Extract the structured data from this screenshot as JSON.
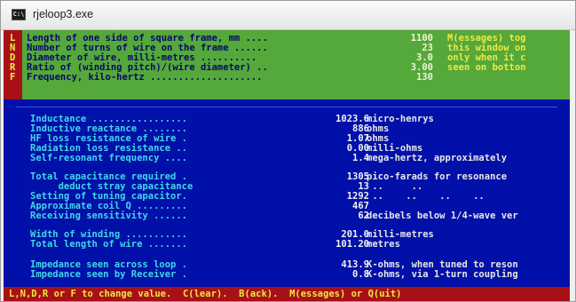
{
  "window": {
    "title": "rjeloop3.exe",
    "icon": "console-icon",
    "icon_text": "C:\\"
  },
  "parameters": [
    {
      "key": "L",
      "label": "Length of one side of square frame, mm ....",
      "value": "1100"
    },
    {
      "key": "N",
      "label": "Number of turns of wire on the frame ......",
      "value": "23"
    },
    {
      "key": "D",
      "label": "Diameter of wire, milli-metres ..........",
      "value": "3.0"
    },
    {
      "key": "R",
      "label": "Ratio of (winding pitch)/(wire diameter) ..",
      "value": "3.00"
    },
    {
      "key": "F",
      "label": "Frequency, kilo-hertz ....................",
      "value": "130"
    }
  ],
  "messages": [
    "M(essages) tog",
    "this window on",
    "only when it c",
    "seen on botton",
    ""
  ],
  "results_group1": [
    {
      "label": "Inductance .................",
      "value": "1023.6",
      "unit": "micro-henrys"
    },
    {
      "label": "Inductive reactance ........",
      "value": "886",
      "unit": "ohms"
    },
    {
      "label": "HF loss resistance of wire .",
      "value": "1.07",
      "unit": "ohms"
    },
    {
      "label": "Radiation loss resistance ..",
      "value": "0.00",
      "unit": "milli-ohms"
    },
    {
      "label": "Self-resonant frequency ....",
      "value": "1.4",
      "unit": "mega-hertz, approximately"
    }
  ],
  "results_group2": [
    {
      "label": "Total capacitance required .",
      "value": "1305",
      "unit": "pico-farads for resonance"
    },
    {
      "label": "     deduct stray capacitance",
      "value": "13",
      "unit": " ..     .."
    },
    {
      "label": "Setting of tuning capacitor.",
      "value": "1292",
      "unit": " ..    ..    ..    .."
    },
    {
      "label": "Approximate coil Q .........",
      "value": "467",
      "unit": ""
    },
    {
      "label": "Receiving sensitivity ......",
      "value": "62",
      "unit": "decibels below 1/4-wave ver"
    }
  ],
  "results_group3": [
    {
      "label": "Width of winding ...........",
      "value": "201.0",
      "unit": "milli-metres"
    },
    {
      "label": "Total length of wire .......",
      "value": "101.20",
      "unit": "metres"
    }
  ],
  "results_group4": [
    {
      "label": "Impedance seen across loop .",
      "value": "413.9",
      "unit": "K-ohms, when tuned to reson"
    },
    {
      "label": "Impedance seen by Receiver .",
      "value": "0.8",
      "unit": "K-ohms, via 1-turn coupling"
    }
  ],
  "status_bar": {
    "text": "L,N,D,R or F to change value.  C(lear).  B(ack).  M(essages) or Q(uit)"
  },
  "colors": {
    "console_bg": "#0010a8",
    "input_panel": "#55a83a",
    "key_strip": "#a81018",
    "label_text": "#40d8e8",
    "highlight": "#f0e840"
  }
}
